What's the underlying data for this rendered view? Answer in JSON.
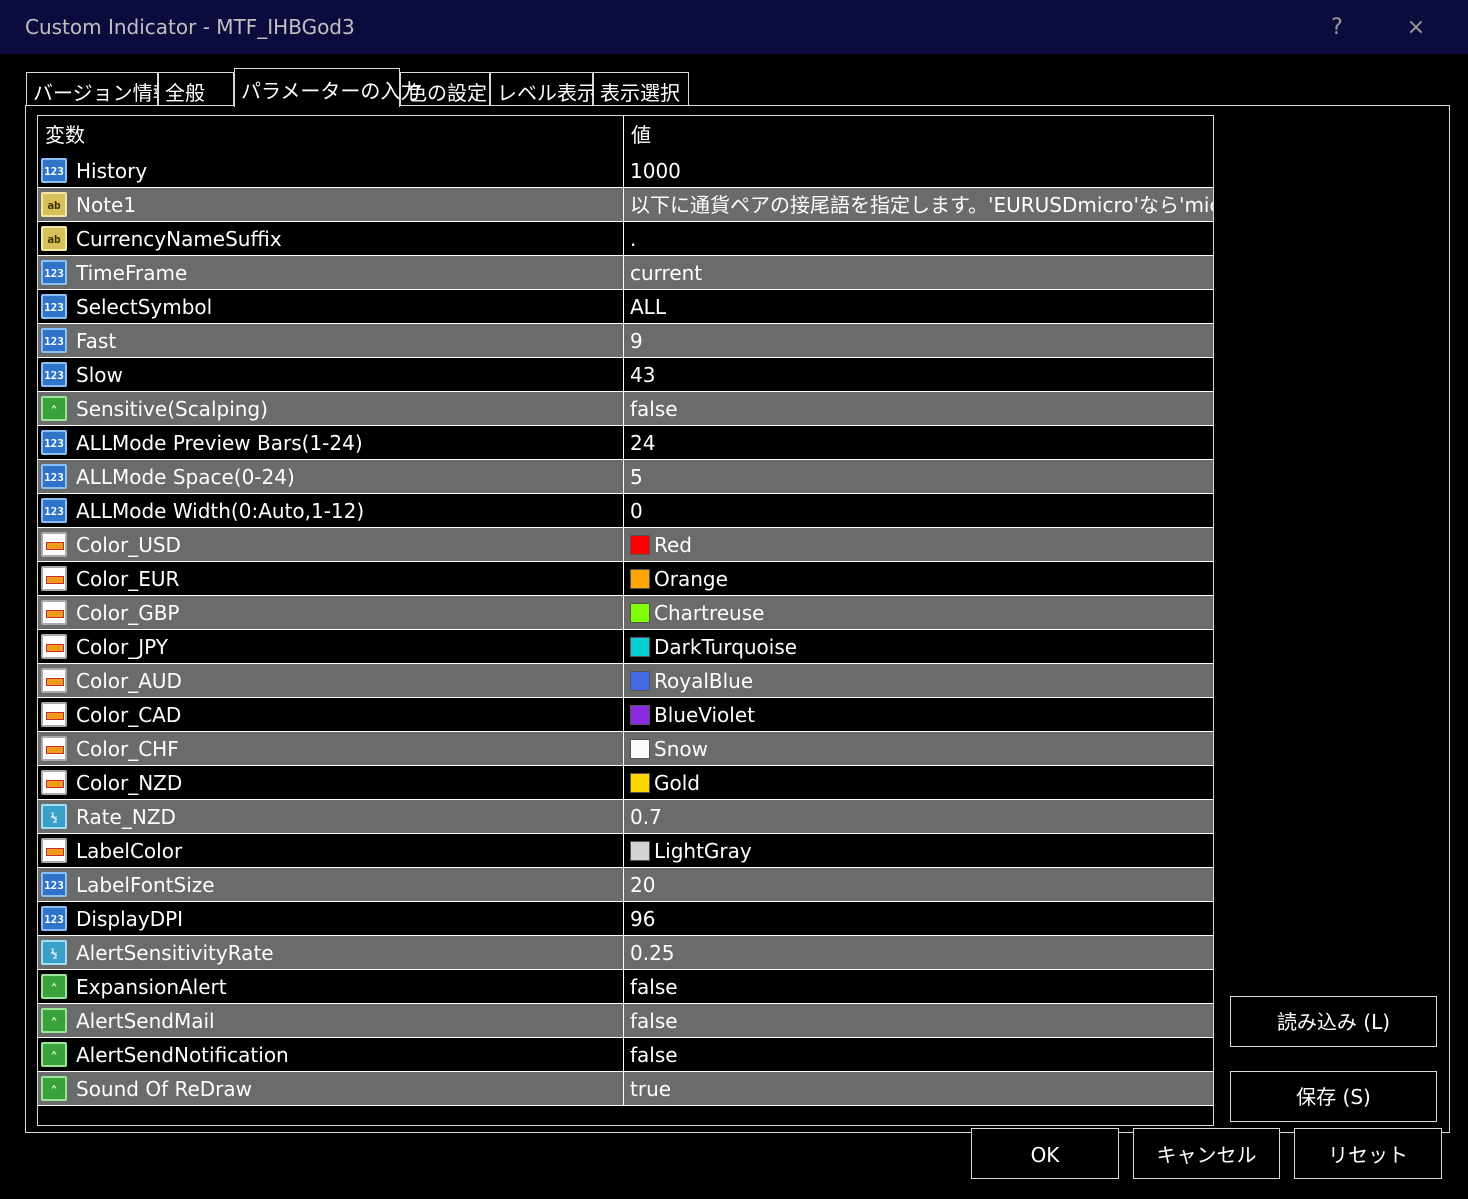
{
  "window": {
    "title": "Custom Indicator - MTF_IHBGod3",
    "help_label": "?",
    "close_label": "×"
  },
  "tabs": [
    {
      "label": "バージョン情報",
      "active": false
    },
    {
      "label": "全般",
      "active": false
    },
    {
      "label": "パラメーターの入力",
      "active": true
    },
    {
      "label": "色の設定",
      "active": false
    },
    {
      "label": "レベル表示",
      "active": false
    },
    {
      "label": "表示選択",
      "active": false
    }
  ],
  "table": {
    "headers": {
      "name": "変数",
      "value": "値"
    },
    "rows": [
      {
        "icon": "int",
        "name": "History",
        "value": "1000"
      },
      {
        "icon": "str",
        "name": "Note1",
        "value": "以下に通貨ペアの接尾語を指定します。'EURUSDmicro'なら'micro'"
      },
      {
        "icon": "str",
        "name": "CurrencyNameSuffix",
        "value": "."
      },
      {
        "icon": "int",
        "name": "TimeFrame",
        "value": "current"
      },
      {
        "icon": "int",
        "name": "SelectSymbol",
        "value": "ALL"
      },
      {
        "icon": "int",
        "name": "Fast",
        "value": "9"
      },
      {
        "icon": "int",
        "name": "Slow",
        "value": "43"
      },
      {
        "icon": "bool",
        "name": "Sensitive(Scalping)",
        "value": "false"
      },
      {
        "icon": "int",
        "name": "ALLMode Preview Bars(1-24)",
        "value": "24"
      },
      {
        "icon": "int",
        "name": "ALLMode Space(0-24)",
        "value": "5"
      },
      {
        "icon": "int",
        "name": "ALLMode Width(0:Auto,1-12)",
        "value": "0"
      },
      {
        "icon": "color",
        "name": "Color_USD",
        "value": "Red",
        "swatch": "#ff0000"
      },
      {
        "icon": "color",
        "name": "Color_EUR",
        "value": "Orange",
        "swatch": "#ffa500"
      },
      {
        "icon": "color",
        "name": "Color_GBP",
        "value": "Chartreuse",
        "swatch": "#7fff00"
      },
      {
        "icon": "color",
        "name": "Color_JPY",
        "value": "DarkTurquoise",
        "swatch": "#00ced1"
      },
      {
        "icon": "color",
        "name": "Color_AUD",
        "value": "RoyalBlue",
        "swatch": "#4169e1"
      },
      {
        "icon": "color",
        "name": "Color_CAD",
        "value": "BlueViolet",
        "swatch": "#8a2be2"
      },
      {
        "icon": "color",
        "name": "Color_CHF",
        "value": "Snow",
        "swatch": "#fffafa"
      },
      {
        "icon": "color",
        "name": "Color_NZD",
        "value": "Gold",
        "swatch": "#ffd700"
      },
      {
        "icon": "double",
        "name": "Rate_NZD",
        "value": "0.7"
      },
      {
        "icon": "color",
        "name": "LabelColor",
        "value": "LightGray",
        "swatch": "#d3d3d3"
      },
      {
        "icon": "int",
        "name": "LabelFontSize",
        "value": "20"
      },
      {
        "icon": "int",
        "name": "DisplayDPI",
        "value": "96"
      },
      {
        "icon": "double",
        "name": "AlertSensitivityRate",
        "value": "0.25"
      },
      {
        "icon": "bool",
        "name": "ExpansionAlert",
        "value": "false"
      },
      {
        "icon": "bool",
        "name": "AlertSendMail",
        "value": "false"
      },
      {
        "icon": "bool",
        "name": "AlertSendNotification",
        "value": "false"
      },
      {
        "icon": "bool",
        "name": "Sound Of ReDraw",
        "value": "true"
      }
    ]
  },
  "icon_glyphs": {
    "int": "123",
    "str": "ab",
    "bool": "⌃",
    "color": "",
    "double": "½"
  },
  "icon_names": {
    "int": "integer-type-icon",
    "str": "string-type-icon",
    "bool": "boolean-type-icon",
    "color": "color-type-icon",
    "double": "double-type-icon"
  },
  "buttons": {
    "load": "読み込み (L)",
    "save": "保存 (S)",
    "ok": "OK",
    "cancel": "キャンセル",
    "reset": "リセット"
  }
}
